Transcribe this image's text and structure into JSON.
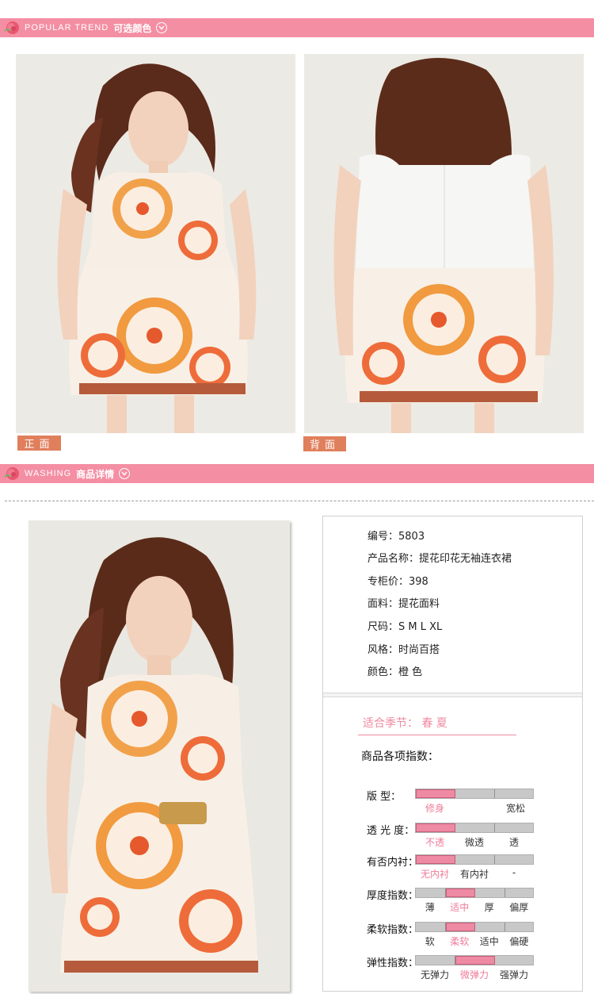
{
  "sections": {
    "popular": {
      "en": "POPULAR TREND",
      "cn": "可选颜色"
    },
    "washing": {
      "en": "WASHING",
      "cn": "商品详情"
    }
  },
  "photos": {
    "front_label": "正面",
    "back_label": "背面"
  },
  "product": {
    "lines": [
      "编号：5803",
      "产品名称：提花印花无袖连衣裙",
      "专柜价：398",
      "面料：提花面料",
      "尺码：S  M L XL",
      "风格：时尚百搭",
      "颜色：橙 色"
    ],
    "season": "适合季节：  春  夏",
    "index_title": "商品各项指数：",
    "attributes": [
      {
        "label": "版      型：",
        "options": [
          "修身",
          "",
          "宽松"
        ],
        "selected": 0
      },
      {
        "label": "透  光  度：",
        "options": [
          "不透",
          "微透",
          "透"
        ],
        "selected": 0
      },
      {
        "label": "有否内衬：",
        "options": [
          "无内衬",
          "有内衬",
          "-"
        ],
        "selected": 0
      },
      {
        "label": "厚度指数：",
        "options": [
          "薄",
          "适中",
          "厚",
          "偏厚"
        ],
        "selected": 1
      },
      {
        "label": "柔软指数：",
        "options": [
          "软",
          "柔软",
          "适中",
          "偏硬"
        ],
        "selected": 1
      },
      {
        "label": "弹性指数：",
        "options": [
          "无弹力",
          "微弹力",
          "强弹力"
        ],
        "selected": 1
      }
    ]
  },
  "colors": {
    "banner": "#f48ea3",
    "label_bg": "#e07f5c",
    "accent_pink": "#ef8aa0",
    "bar_fill": "#ee8aa3"
  }
}
